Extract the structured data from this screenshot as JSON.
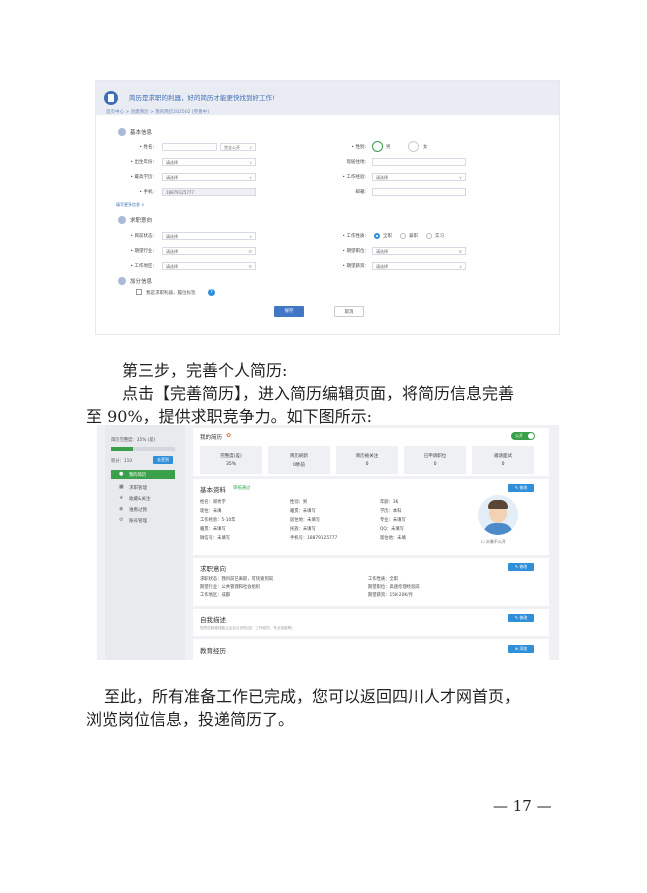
{
  "form_screenshot": {
    "banner": "简历是求职的利器，好的简历才能更快找到好工作!",
    "breadcrumb": "首页中心 > 创建简历 > 我的简历202502 [完善中]",
    "basic": {
      "title": "基本信息",
      "name_label": "• 姓名:",
      "name_public": "完全公开",
      "gender_label": "• 性别:",
      "male": "男",
      "female": "女",
      "birth_label": "• 出生年份:",
      "birth_placeholder": "请选择",
      "residence_label": "现居住地:",
      "edu_label": "• 最高学历:",
      "edu_placeholder": "请选择",
      "exp_label": "• 工作经验:",
      "exp_placeholder": "请选择",
      "phone_label": "• 手机:",
      "phone_value": "18879125777",
      "email_label": "邮箱:",
      "more_link": "填写更多信息 ∨"
    },
    "intent": {
      "title": "求职意向",
      "status_label": "• 目前状态:",
      "status_placeholder": "请选择",
      "type_label": "• 工作性质:",
      "fulltime": "全职",
      "parttime": "兼职",
      "intern": "实习",
      "industry_label": "• 期望行业:",
      "industry_placeholder": "请选择",
      "position_label": "• 期望职位:",
      "position_placeholder": "请选择",
      "area_label": "• 工作地区:",
      "area_placeholder": "请选择",
      "salary_label": "• 期望薪资:",
      "salary_placeholder": "请选择"
    },
    "extra": {
      "title": "加分信息",
      "checkbox_label": "我是求职利器，履位标签"
    },
    "save_button": "保存",
    "cancel_button": "取消"
  },
  "caption_step3": "第三步，完善个人简历:",
  "caption_body_line1": "点击【完善简历】，进入简历编辑页面，将简历信息完善",
  "caption_body_line2": "至 90%，提供求职竞争力。如下图所示:",
  "resume_screenshot": {
    "sidebar": {
      "completeness": "简历完整度：35% (差)",
      "completeness_percent": 35,
      "points": "积分：110",
      "points_button": "去签到",
      "menu": [
        "我的简历",
        "求职管理",
        "收藏&关注",
        "谁看过我",
        "账号管理"
      ]
    },
    "header": {
      "title": "我的简历",
      "toggle_label": "公开",
      "stats": [
        {
          "label": "完整度(差)",
          "value": "35%"
        },
        {
          "label": "简历刷新",
          "value": "0秒前"
        },
        {
          "label": "简历被关注",
          "value": "0"
        },
        {
          "label": "已申请职位",
          "value": "0"
        },
        {
          "label": "邀请面试",
          "value": "0"
        }
      ]
    },
    "basic": {
      "title": "基本资料",
      "status": "审核通过",
      "edit": "修改",
      "rows": [
        [
          "姓名：郑秀字",
          "性别：男",
          "年龄：36"
        ],
        [
          "现住：未填",
          "籍贯：未填写",
          "学历：本科"
        ],
        [
          "工作经验：5-10年",
          "居住地：未填写",
          "专业：未填写"
        ],
        [
          "籍贯：未填写",
          "民族：未填写",
          "QQ：未填写"
        ],
        [
          "微信号：未填写",
          "手机号：18879125777",
          "现住地：未填"
        ]
      ],
      "avatar_note": "头像不公开"
    },
    "intent": {
      "title": "求职意向",
      "edit": "修改",
      "status": "求职状态：我目前已离职，可快速到岗",
      "type": "工作性质：全职",
      "industry": "期望行业：公共管理和社会组织",
      "position": "期望职位：高速伦理经验岗",
      "area": "工作地区：成都",
      "salary": "期望薪资：15K-20K/月"
    },
    "self": {
      "title": "自我描述",
      "edit": "修改",
      "hint": "您的自我描述能让企业认识您(如：工作经历、专业技能等)"
    },
    "edu": {
      "title": "教育经历",
      "add": "添加"
    }
  },
  "caption_final_line1": "至此，所有准备工作已完成，您可以返回四川人才网首页，",
  "caption_final_line2": "浏览岗位信息，投递简历了。",
  "page_number": "— 17 —"
}
